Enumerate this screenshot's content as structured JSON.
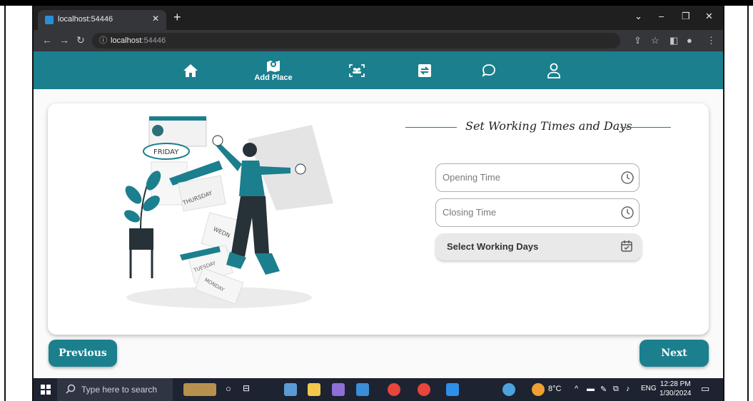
{
  "browser": {
    "tab_title": "localhost:54446",
    "url_host": "localhost",
    "url_port": ":54446"
  },
  "nav": {
    "home_icon": "home-icon",
    "add_place_label": "Add Place",
    "items": [
      "home-icon",
      "map-pin-icon",
      "scan-group-icon",
      "swap-icon",
      "chat-icon",
      "user-icon"
    ]
  },
  "form": {
    "heading": "Set Working Times and Days",
    "opening_time_placeholder": "Opening Time",
    "closing_time_placeholder": "Closing Time",
    "select_days_label": "Select Working Days"
  },
  "illustration": {
    "friday": "FRIDAY",
    "thursday": "THURSDAY",
    "wednesday": "WEDN",
    "tuesday": "TUESDAY",
    "monday": "MONDAY"
  },
  "buttons": {
    "previous": "Previous",
    "next": "Next"
  },
  "taskbar": {
    "search_placeholder": "Type here to search",
    "weather": "8°C",
    "lang": "ENG",
    "time": "12:28 PM",
    "date": "1/30/2024"
  },
  "colors": {
    "accent": "#1b7f8e",
    "chrome_dark": "#1f1f1f"
  }
}
